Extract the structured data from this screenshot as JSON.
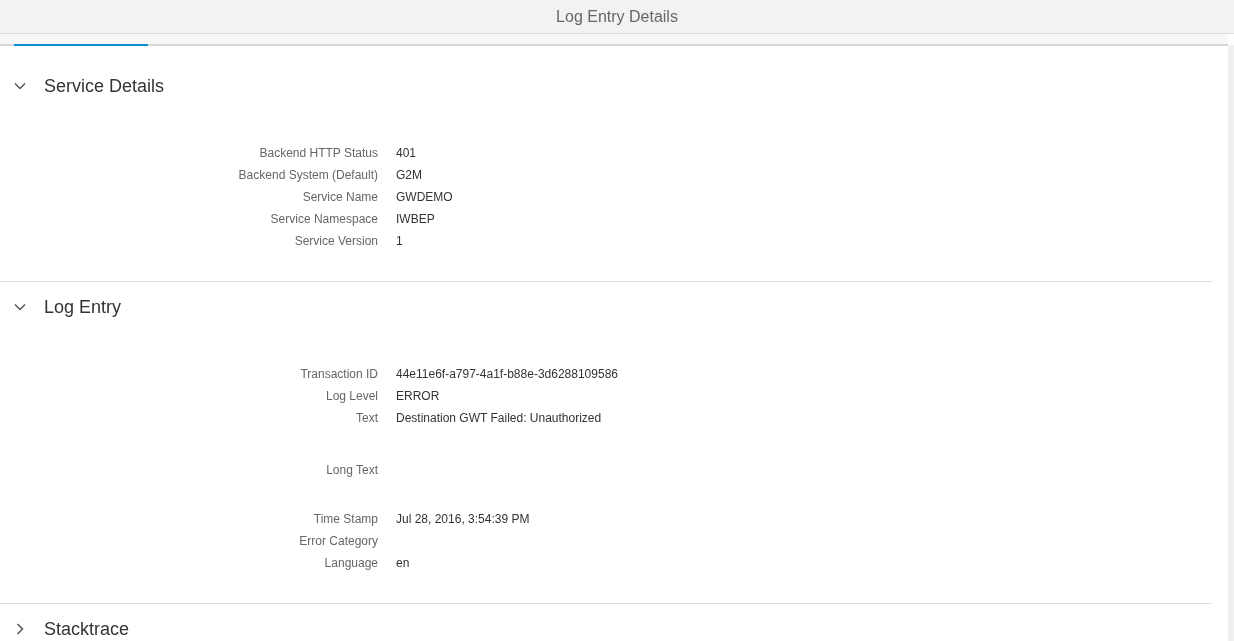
{
  "window": {
    "title": "Log Entry Details"
  },
  "tabs": [
    {
      "selected": true
    }
  ],
  "sections": [
    {
      "title": "Service Details",
      "expanded": true,
      "fields": [
        {
          "kind": "text",
          "label": "Backend HTTP Status",
          "value": "401"
        },
        {
          "kind": "text",
          "label": "Backend System (Default)",
          "value": "G2M"
        },
        {
          "kind": "text",
          "label": "Service Name",
          "value": "GWDEMO"
        },
        {
          "kind": "text",
          "label": "Service Namespace",
          "value": "IWBEP"
        },
        {
          "kind": "text",
          "label": "Service Version",
          "value": "1"
        }
      ]
    },
    {
      "title": "Log Entry",
      "expanded": true,
      "fields": [
        {
          "kind": "text",
          "label": "Transaction ID",
          "value": "44e11e6f-a797-4a1f-b88e-3d6288109586"
        },
        {
          "kind": "text",
          "label": "Log Level",
          "value": "ERROR"
        },
        {
          "kind": "text",
          "label": "Text",
          "value": "Destination GWT Failed: Unauthorized"
        },
        {
          "kind": "long",
          "label": "Long Text"
        },
        {
          "kind": "text",
          "label": "Time Stamp",
          "value": "Jul 28, 2016, 3:54:39 PM"
        },
        {
          "kind": "text",
          "label": "Error Category"
        },
        {
          "kind": "text",
          "label": "Language",
          "value": "en"
        }
      ]
    },
    {
      "title": "Stacktrace",
      "expanded": false
    }
  ]
}
